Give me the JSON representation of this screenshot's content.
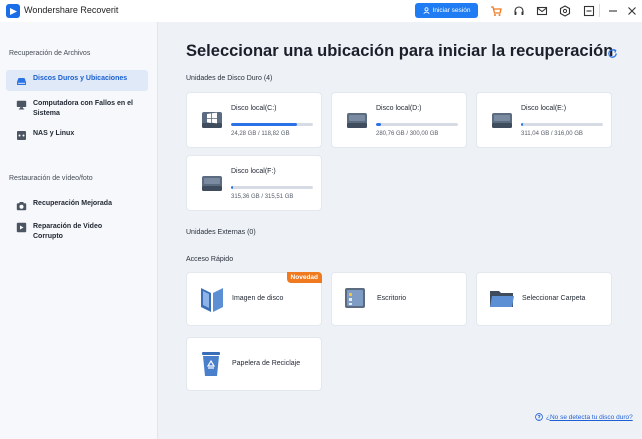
{
  "app": {
    "title": "Wondershare Recoverit",
    "signin_label": "Iniciar sesión"
  },
  "titlebar_icons": [
    "cart-icon",
    "headset-icon",
    "mail-icon",
    "settings-cube-icon",
    "minimize-icon",
    "close-icon"
  ],
  "sidebar": {
    "section1": "Recuperación de Archivos",
    "items1": [
      {
        "label": "Discos Duros y Ubicaciones",
        "icon": "hard-drive-icon",
        "active": true
      },
      {
        "label": "Computadora con Fallos en el Sistema",
        "icon": "monitor-icon",
        "active": false
      },
      {
        "label": "NAS y Linux",
        "icon": "nas-icon",
        "active": false
      }
    ],
    "section2": "Restauración de vídeo/foto",
    "items2": [
      {
        "label": "Recuperación Mejorada",
        "icon": "camera-icon",
        "active": false
      },
      {
        "label": "Reparación de Video Corrupto",
        "icon": "video-repair-icon",
        "active": false
      }
    ]
  },
  "main": {
    "title": "Seleccionar una ubicación para iniciar la recuperación",
    "hdd_section": "Unidades de Disco Duro (4)",
    "drives": [
      {
        "name": "Disco local(C:)",
        "size": "24,28 GB / 118,82 GB",
        "used_fraction": 0.8
      },
      {
        "name": "Disco local(D:)",
        "size": "280,76 GB / 300,00 GB",
        "used_fraction": 0.06
      },
      {
        "name": "Disco local(E:)",
        "size": "311,04 GB / 316,00 GB",
        "used_fraction": 0.03
      },
      {
        "name": "Disco local(F:)",
        "size": "315,36 GB / 315,51 GB",
        "used_fraction": 0.03
      }
    ],
    "external_section": "Unidades Externas (0)",
    "quick_section": "Acceso Rápido",
    "quick": [
      {
        "label": "Imagen de disco",
        "badge": "Novedad"
      },
      {
        "label": "Escritorio",
        "badge": ""
      },
      {
        "label": "Seleccionar Carpeta",
        "badge": ""
      },
      {
        "label": "Papelera de Reciclaje",
        "badge": ""
      }
    ],
    "help_link": "¿No se detecta tu disco duro?"
  },
  "colors": {
    "accent": "#1f7cf2",
    "badge": "#f07a1f",
    "background": "#eef2f7"
  }
}
